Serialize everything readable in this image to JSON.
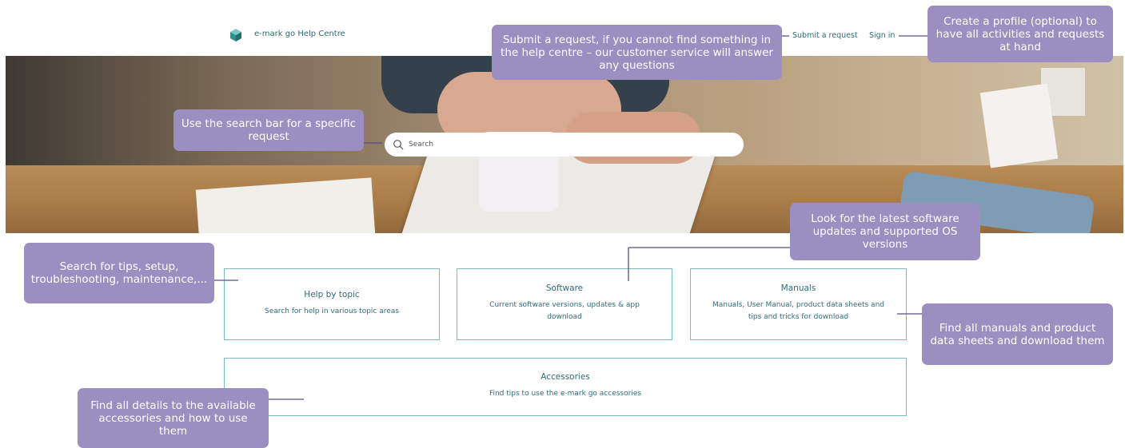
{
  "header": {
    "brand_name": "e-mark go Help Centre",
    "nav": {
      "submit_request": "Submit a request",
      "sign_in": "Sign in"
    }
  },
  "search": {
    "placeholder": "Search"
  },
  "cards": {
    "help_by_topic": {
      "title": "Help by topic",
      "description": "Search for help in various topic areas"
    },
    "software": {
      "title": "Software",
      "description": "Current software versions, updates & app download"
    },
    "manuals": {
      "title": "Manuals",
      "description": "Manuals, User Manual, product data sheets and tips and tricks for download"
    },
    "accessories": {
      "title": "Accessories",
      "description": "Find tips to use the e-mark go accessories"
    }
  },
  "callouts": {
    "submit": "Submit a request, if you cannot find something in the help centre – our customer service will answer any questions",
    "profile": "Create a profile (optional) to have all activities and requests at hand",
    "search": "Use the search bar for a specific request",
    "software": "Look for the latest software updates and supported OS versions",
    "topics": "Search for tips, setup, troubleshooting, maintenance,...",
    "manuals": "Find all manuals and product data sheets and download them",
    "accessories": "Find all details to the available accessories and how to use them"
  },
  "colors": {
    "accent": "#2e6b73",
    "card_border": "#79b9bf",
    "callout_bg": "#9b8ec0",
    "callout_line": "#5a4e86"
  },
  "icons": {
    "logo": "cube-logo-icon",
    "search": "search-icon"
  }
}
